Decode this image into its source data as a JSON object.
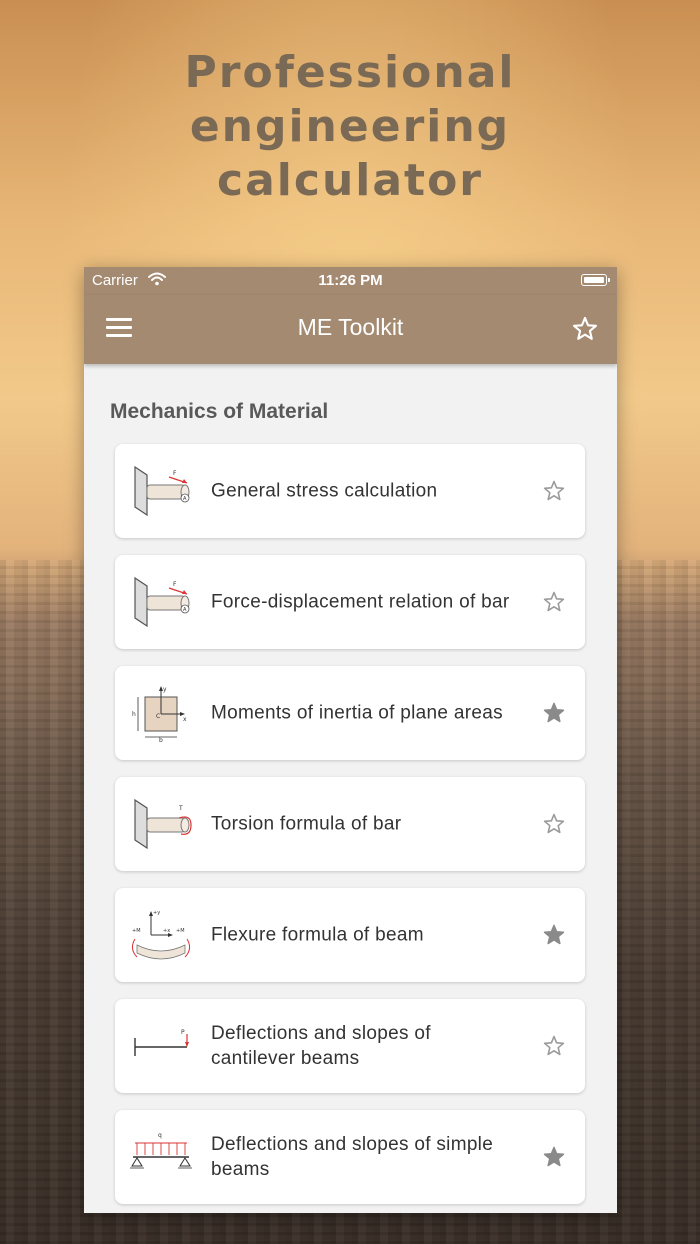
{
  "promo": {
    "headline": [
      "Professional",
      "engineering",
      "calculator"
    ]
  },
  "status": {
    "carrier": "Carrier",
    "time": "11:26 PM"
  },
  "appbar": {
    "title": "ME Toolkit"
  },
  "section": {
    "title": "Mechanics of Material"
  },
  "items": [
    {
      "label": "General stress calculation",
      "icon": "cantilever-bar-force-icon",
      "favorite": false
    },
    {
      "label": "Force-displacement relation of bar",
      "icon": "cantilever-bar-force-icon",
      "favorite": false
    },
    {
      "label": "Moments of inertia of plane areas",
      "icon": "rectangle-section-icon",
      "favorite": true
    },
    {
      "label": "Torsion formula of bar",
      "icon": "cantilever-bar-torque-icon",
      "favorite": false
    },
    {
      "label": "Flexure formula of beam",
      "icon": "beam-bending-icon",
      "favorite": true
    },
    {
      "label": "Deflections and slopes of cantilever beams",
      "icon": "cantilever-beam-icon",
      "favorite": false
    },
    {
      "label": "Deflections and slopes of simple beams",
      "icon": "simple-beam-icon",
      "favorite": true
    }
  ],
  "colors": {
    "appbar": "#a58a72",
    "headline": "#7a6a55",
    "star_filled": "#8a8a8a",
    "star_outline": "#9a9a9a"
  }
}
